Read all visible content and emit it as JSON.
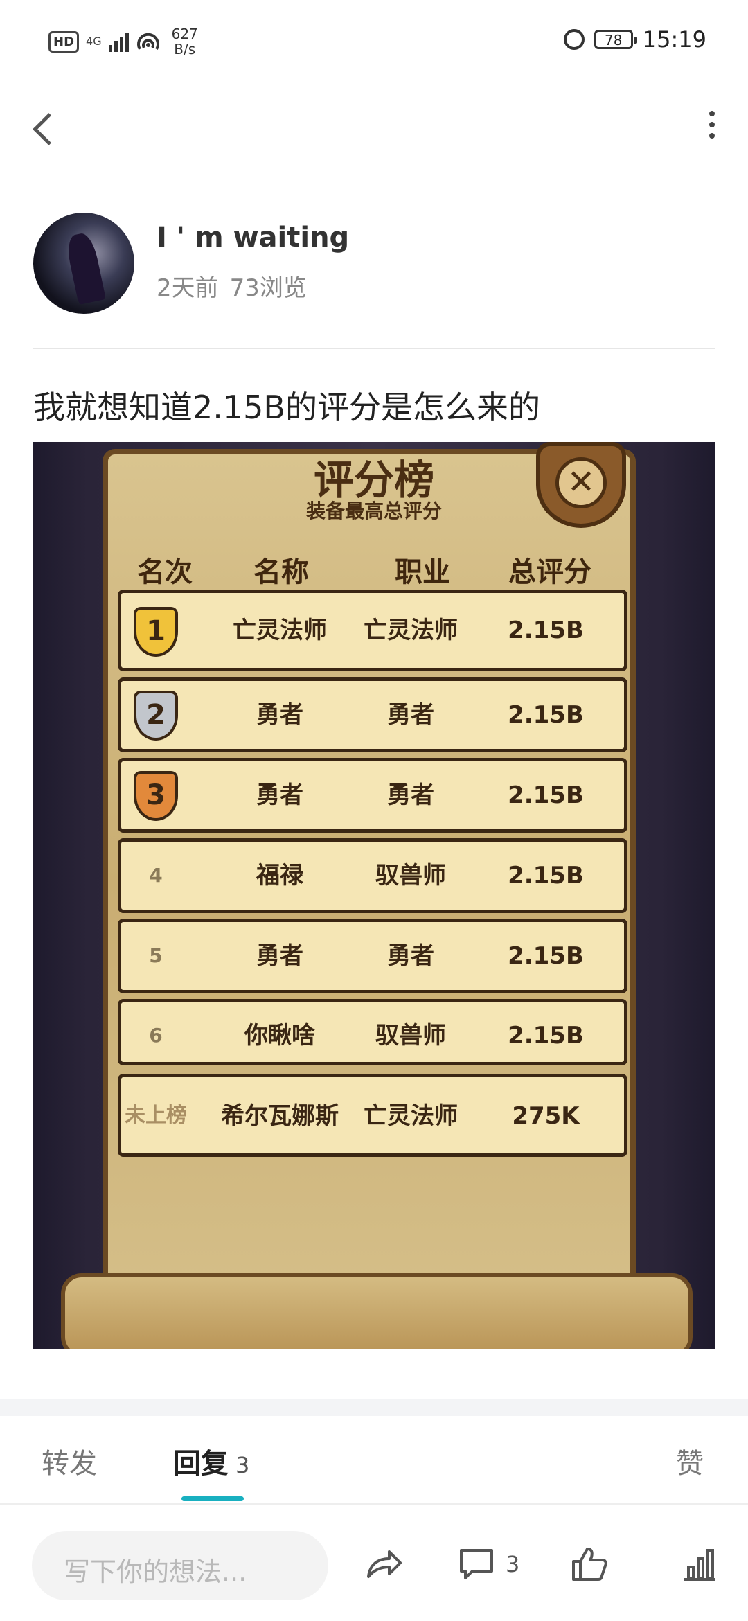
{
  "status_bar": {
    "hd": "HD",
    "network": "4G",
    "speed_value": "627",
    "speed_unit": "B/s",
    "battery": "78",
    "time": "15:19"
  },
  "icons": {
    "back": "back-arrow-icon",
    "more": "more-vertical-icon",
    "share": "share-icon",
    "comment": "comment-icon",
    "like": "thumbs-up-icon",
    "stats": "bar-chart-icon"
  },
  "author": {
    "name": "I ' m waiting",
    "time": "2天前",
    "views": "73浏览"
  },
  "post": {
    "text": "我就想知道2.15B的评分是怎么来的"
  },
  "leaderboard": {
    "title": "评分榜",
    "subtitle": "装备最高总评分",
    "close": "✕",
    "headers": [
      "名次",
      "名称",
      "职业",
      "总评分"
    ],
    "rows": [
      {
        "rank": "1",
        "name": "亡灵法师",
        "job": "亡灵法师",
        "score": "2.15B"
      },
      {
        "rank": "2",
        "name": "勇者",
        "job": "勇者",
        "score": "2.15B"
      },
      {
        "rank": "3",
        "name": "勇者",
        "job": "勇者",
        "score": "2.15B"
      },
      {
        "rank": "4",
        "name": "福禄",
        "job": "驭兽师",
        "score": "2.15B"
      },
      {
        "rank": "5",
        "name": "勇者",
        "job": "勇者",
        "score": "2.15B"
      },
      {
        "rank": "6",
        "name": "你瞅啥",
        "job": "驭兽师",
        "score": "2.15B"
      }
    ],
    "self_row": {
      "rank": "未上榜",
      "name": "希尔瓦娜斯",
      "job": "亡灵法师",
      "score": "275K"
    }
  },
  "tabs": {
    "forward": "转发",
    "reply": "回复",
    "reply_count": "3",
    "like": "赞"
  },
  "bottom_bar": {
    "placeholder": "写下你的想法...",
    "comment_count": "3"
  },
  "colors": {
    "accent": "#19b0c0"
  }
}
